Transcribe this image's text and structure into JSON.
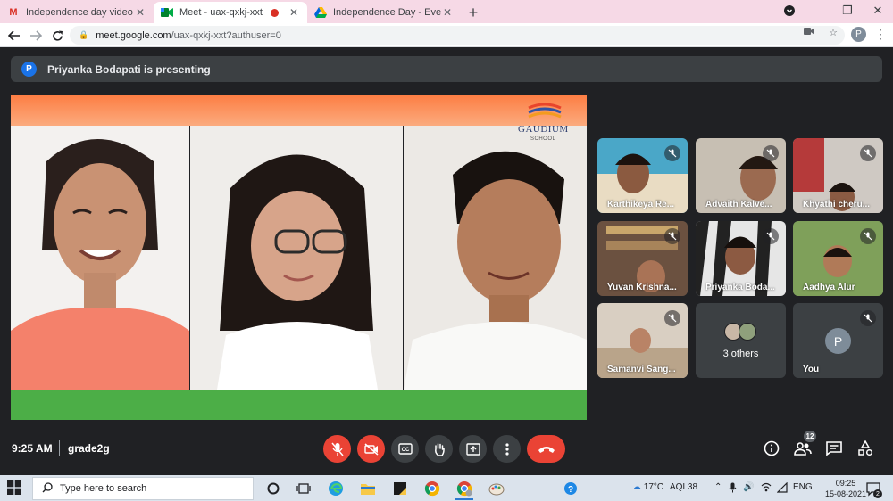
{
  "browser": {
    "tabs": [
      {
        "label": "Independence day video link - pj"
      },
      {
        "label": "Meet - uax-qxkj-xxt"
      },
      {
        "label": "Independence Day - Event Video"
      }
    ],
    "url_host": "meet.google.com",
    "url_path": "/uax-qxkj-xxt?authuser=0",
    "profile_initial": "P"
  },
  "meet": {
    "presenter_initial": "P",
    "presenting_text": "Priyanka Bodapati is presenting",
    "logo_name": "GAUDIUM",
    "logo_sub": "SCHOOL",
    "participants": [
      {
        "name": "Karthikeya Re..."
      },
      {
        "name": "Advaith Kalve..."
      },
      {
        "name": "Khyathi cheru..."
      },
      {
        "name": "Yuvan Krishna..."
      },
      {
        "name": "Priyanka Boda..."
      },
      {
        "name": "Aadhya Alur"
      },
      {
        "name": "Samanvi Sang..."
      },
      {
        "name": "3 others"
      },
      {
        "name": "You",
        "initial": "P"
      }
    ],
    "time": "9:25 AM",
    "meeting_name": "grade2g",
    "people_count": "12",
    "colors": {
      "danger": "#ea4335",
      "panel": "#3c4043",
      "background": "#202124"
    }
  },
  "taskbar": {
    "search_placeholder": "Type here to search",
    "weather": "17°C",
    "aqi": "AQI 38",
    "language": "ENG",
    "clock_time": "09:25",
    "clock_date": "15-08-2021",
    "notification_count": "2"
  }
}
